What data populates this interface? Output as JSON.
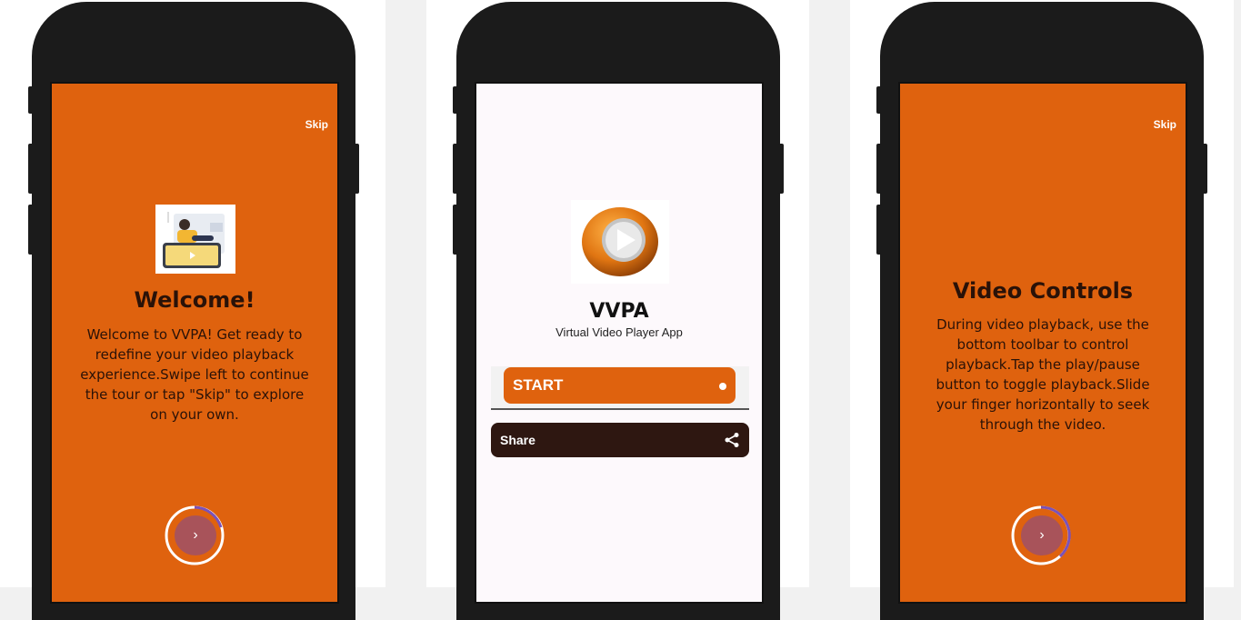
{
  "screens": {
    "welcome": {
      "skip_label": "Skip",
      "title": "Welcome!",
      "body": "Welcome to VVPA! Get ready to redefine your video playback experience.Swipe left to continue the tour or tap \"Skip\" to explore on your own.",
      "next_label": "›"
    },
    "home": {
      "app_name": "VVPA",
      "app_subtitle": "Virtual Video Player App",
      "start_label": "START",
      "share_label": "Share"
    },
    "controls": {
      "skip_label": "Skip",
      "title": "Video Controls",
      "body": "During video playback, use the bottom toolbar to control playback.Tap the play/pause button to toggle playback.Slide your finger horizontally to seek through the video.",
      "next_label": "›"
    }
  },
  "colors": {
    "accent": "#df620e",
    "dark": "#2e1711",
    "ring": "#7b52b8"
  }
}
